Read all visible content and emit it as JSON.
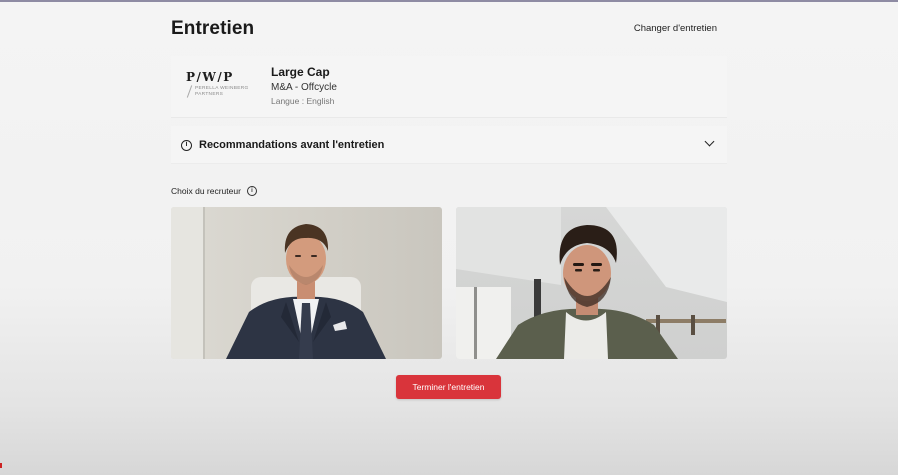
{
  "header": {
    "title": "Entretien",
    "change_link": "Changer d'entretien"
  },
  "interview": {
    "logo": {
      "mark": "P/W/P",
      "subline": "PERELLA WEINBERG PARTNERS"
    },
    "title": "Large Cap",
    "subtitle": "M&A - Offcycle",
    "language": "Langue : English"
  },
  "recommendations": {
    "label": "Recommandations avant l'entretien",
    "icon": "info-icon"
  },
  "recruiter": {
    "label": "Choix du recruteur",
    "icon": "info-icon"
  },
  "actions": {
    "end_label": "Terminer l'entretien"
  },
  "colors": {
    "accent_red": "#d9343b",
    "background": "#f4f4f4",
    "text": "#1a1a1a"
  }
}
